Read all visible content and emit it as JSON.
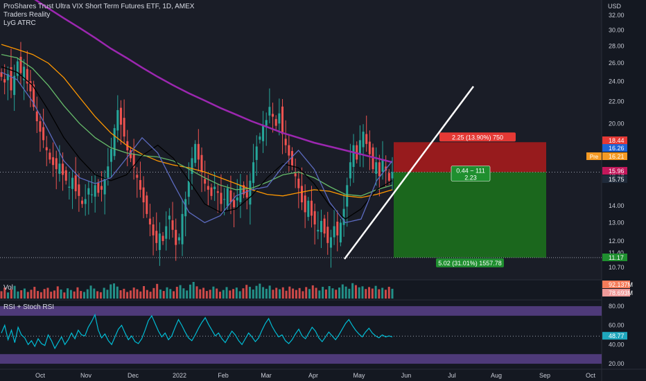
{
  "header": {
    "title": "ProShares Trust Ultra VIX Short Term Futures ETF, 1D, AMEX",
    "indicator_1": "Traders Reality",
    "indicator_2": "LyG ATRC"
  },
  "colors": {
    "background": "#141821",
    "up_candle": "#26a69a",
    "down_candle": "#ef5350",
    "ema_purple": "#9c27b0",
    "rsi_line": "#00bcd4",
    "rsi_band": "#7e57c2",
    "stop_zone": "#b71c1c",
    "target_zone": "#1b7a1b"
  },
  "chart_data": {
    "type": "candlestick",
    "symbol": "UVXY",
    "exchange": "AMEX",
    "timeframe": "1D",
    "currency": "USD",
    "x_ticks": [
      "Oct",
      "Nov",
      "Dec",
      "2022",
      "Feb",
      "Mar",
      "Apr",
      "May",
      "Jun",
      "Jul",
      "Aug",
      "Sep",
      "Oct"
    ],
    "y_ticks": [
      32.0,
      30.0,
      28.0,
      26.0,
      24.0,
      22.0,
      20.0,
      18.0,
      16.0,
      14.0,
      13.0,
      12.0,
      11.4,
      10.7
    ],
    "y_tick_labels": [
      "32.00",
      "30.00",
      "28.00",
      "26.00",
      "24.00",
      "22.00",
      "20.00",
      "18.00",
      "16.19",
      "14.00",
      "13.00",
      "12.00",
      "11.40",
      "10.70"
    ],
    "y_scale": "log",
    "ylim": [
      10.2,
      34.0
    ],
    "closes": [
      24.5,
      23.9,
      24.8,
      23.1,
      24.6,
      26.2,
      24.9,
      25.6,
      23.8,
      23.0,
      21.5,
      20.2,
      19.3,
      18.6,
      17.8,
      17.1,
      16.7,
      16.4,
      16.8,
      16.0,
      15.6,
      15.2,
      15.8,
      14.9,
      14.6,
      14.1,
      14.4,
      15.1,
      14.7,
      15.3,
      14.8,
      15.0,
      15.8,
      16.6,
      17.9,
      19.6,
      21.2,
      19.9,
      18.9,
      17.8,
      17.2,
      16.5,
      15.8,
      15.0,
      14.2,
      13.5,
      12.9,
      12.3,
      11.9,
      12.4,
      12.0,
      12.8,
      13.4,
      12.6,
      11.8,
      12.2,
      13.5,
      14.4,
      15.6,
      17.2,
      18.3,
      17.1,
      16.2,
      15.4,
      15.0,
      14.6,
      15.2,
      14.8,
      14.1,
      14.4,
      15.1,
      14.2,
      13.9,
      14.5,
      15.3,
      14.7,
      14.5,
      15.6,
      16.9,
      18.1,
      18.9,
      19.8,
      20.3,
      21.5,
      20.6,
      19.8,
      20.9,
      19.1,
      18.2,
      17.4,
      16.6,
      15.9,
      15.1,
      14.2,
      13.6,
      14.3,
      13.4,
      12.9,
      12.6,
      13.1,
      12.4,
      11.9,
      12.2,
      12.8,
      12.3,
      13.0,
      13.8,
      15.3,
      16.9,
      18.2,
      17.1,
      18.6,
      19.3,
      18.3,
      17.5,
      16.4,
      16.9,
      15.9,
      17.1,
      16.3,
      15.6,
      16.2
    ],
    "moving_averages": [
      {
        "color": "#9c27b0",
        "values": [
          38.0,
          36.0,
          34.5,
          33.0,
          31.6,
          30.3,
          29.0,
          27.7,
          26.6,
          25.5,
          24.5,
          23.6,
          22.8,
          22.1,
          21.4,
          20.8,
          20.2,
          19.7,
          19.2,
          18.8,
          18.4,
          18.1,
          17.8,
          17.5,
          17.2,
          16.9
        ]
      },
      {
        "color": "#ff9800",
        "values": [
          28.2,
          27.6,
          27.0,
          26.0,
          24.4,
          22.4,
          20.6,
          19.2,
          18.2,
          17.5,
          17.0,
          16.7,
          16.5,
          16.2,
          15.8,
          15.4,
          15.0,
          14.7,
          14.6,
          14.8,
          15.0,
          14.9,
          14.6,
          14.5,
          14.7,
          15.0
        ]
      },
      {
        "color": "#66bb6a",
        "values": [
          27.0,
          26.6,
          25.4,
          23.6,
          21.6,
          20.0,
          18.8,
          18.0,
          17.6,
          17.4,
          17.3,
          17.0,
          16.4,
          15.8,
          15.3,
          15.0,
          15.1,
          15.5,
          16.0,
          16.2,
          15.8,
          15.2,
          14.7,
          14.6,
          15.0,
          15.3
        ]
      },
      {
        "color": "#000000",
        "values": [
          25.6,
          25.0,
          23.6,
          21.2,
          18.8,
          17.2,
          16.0,
          15.6,
          16.0,
          17.4,
          18.2,
          17.2,
          15.6,
          14.1,
          13.6,
          13.8,
          14.6,
          15.8,
          16.8,
          16.5,
          15.4,
          14.0,
          13.2,
          13.8,
          15.0,
          15.6
        ]
      },
      {
        "color": "#5c6bc0",
        "values": [
          25.0,
          24.2,
          22.0,
          19.4,
          17.0,
          15.8,
          15.4,
          15.8,
          17.2,
          18.8,
          17.6,
          15.4,
          13.6,
          13.0,
          13.4,
          14.6,
          15.0,
          15.2,
          16.6,
          17.8,
          16.4,
          14.2,
          13.0,
          13.2,
          15.6,
          17.0
        ]
      }
    ],
    "trendline": {
      "x1_label": "Apr",
      "y1": 11.1,
      "y2": 23.5
    },
    "position": {
      "entry": 16.19,
      "stop": 18.44,
      "target": 11.17,
      "stop_label": "2.25 (13.90%) 750",
      "target_label": "5.02 (31.01%) 1557.78",
      "center_label_1": "0.44 − 111",
      "center_label_2": "2.23"
    },
    "price_tags": [
      {
        "text": "18.44",
        "value": 18.44,
        "color": "#e53935"
      },
      {
        "text": "16.26",
        "value": 16.26,
        "color": "#1e63d6"
      },
      {
        "text": "16.21",
        "value": 16.21,
        "color": "#f59a23"
      },
      {
        "text": "15.96",
        "value": 15.96,
        "color": "#c2185b"
      },
      {
        "text": "15.75",
        "value": 15.75,
        "color": "#1f2a3a"
      },
      {
        "text": "11.17",
        "value": 11.17,
        "color": "#1f8f2f"
      }
    ],
    "pre_market_label": "Pre",
    "volume": {
      "label": "Vol",
      "tags": [
        {
          "text": "92.137M",
          "color": "#f47c5a"
        },
        {
          "text": "78.693M",
          "color": "#ef9a9a"
        }
      ],
      "values": [
        30,
        45,
        25,
        38,
        52,
        29,
        34,
        41,
        27,
        36,
        48,
        31,
        26,
        39,
        44,
        28,
        33,
        50,
        37,
        25,
        42,
        35,
        29,
        46,
        31,
        27,
        38,
        53,
        41,
        30,
        26,
        44,
        36,
        58,
        62,
        49,
        34,
        40,
        27,
        33,
        45,
        38,
        29,
        51,
        35,
        28,
        43,
        60,
        37,
        31,
        46,
        39,
        30,
        48,
        55,
        42,
        33,
        57,
        68,
        50,
        38,
        44,
        31,
        36,
        49,
        41,
        28,
        35,
        47,
        33,
        39,
        45,
        30,
        42,
        56,
        48,
        37,
        52,
        61,
        47,
        40,
        53,
        36,
        44,
        38,
        46,
        32,
        49,
        41,
        35,
        43,
        30,
        47,
        39,
        54,
        44,
        33,
        48,
        37,
        51,
        42,
        36,
        45,
        58,
        49,
        40,
        63,
        55,
        46,
        50,
        39,
        47,
        41,
        52,
        38,
        44,
        36,
        48,
        40
      ]
    },
    "rsi": {
      "label": "RSI + Stoch RSI",
      "value_label": "48.77",
      "y_ticks": [
        "80.00",
        "60.00",
        "40.00",
        "20.00"
      ],
      "band": [
        70,
        80
      ],
      "band_low": [
        20,
        30
      ],
      "values": [
        52,
        60,
        45,
        55,
        42,
        58,
        50,
        47,
        40,
        44,
        38,
        46,
        41,
        39,
        50,
        44,
        36,
        42,
        48,
        40,
        45,
        52,
        46,
        55,
        50,
        49,
        58,
        64,
        71,
        55,
        47,
        51,
        44,
        40,
        48,
        56,
        60,
        52,
        45,
        49,
        43,
        41,
        46,
        55,
        65,
        70,
        62,
        54,
        48,
        52,
        45,
        49,
        58,
        66,
        60,
        53,
        47,
        44,
        50,
        57,
        63,
        68,
        61,
        55,
        49,
        52,
        46,
        42,
        48,
        54,
        50,
        44,
        40,
        46,
        52,
        48,
        43,
        47,
        55,
        62,
        67,
        59,
        53,
        48,
        50,
        44,
        41,
        45,
        51,
        56,
        49,
        46,
        52,
        58,
        54,
        47,
        43,
        48,
        53,
        49,
        45,
        50,
        56,
        62,
        66,
        60,
        55,
        51,
        48,
        53,
        57,
        52,
        49,
        47,
        50,
        48,
        49,
        48
      ]
    }
  }
}
